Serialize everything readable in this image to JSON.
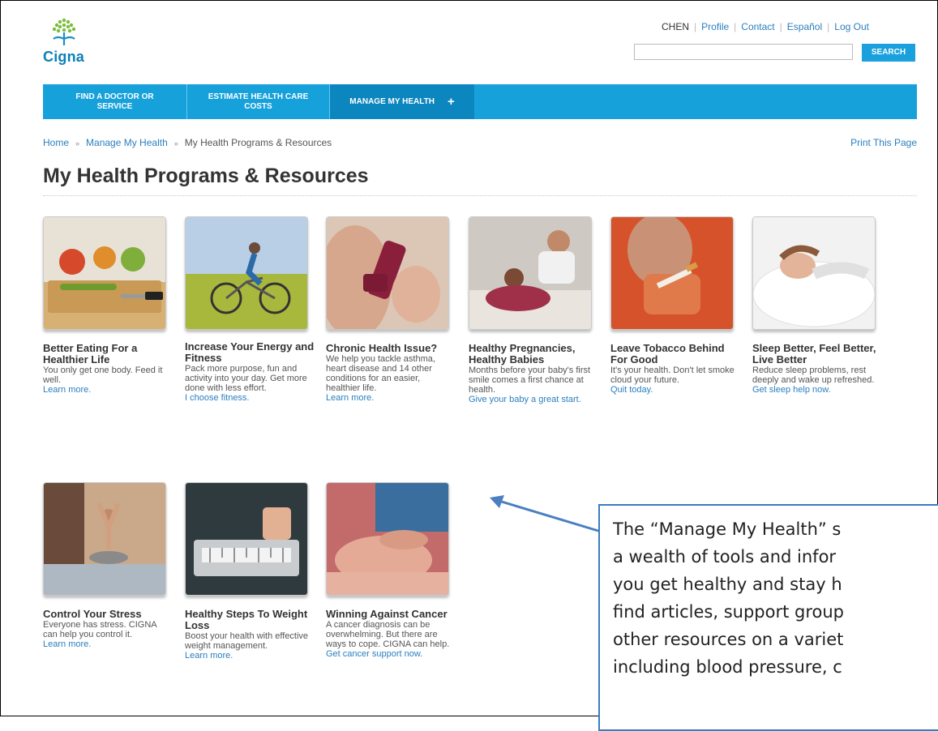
{
  "brand": {
    "logo_text": "Cigna",
    "accent": "#17a1db",
    "link": "#2a7fbf"
  },
  "util": {
    "user": "CHEN",
    "profile": "Profile",
    "contact": "Contact",
    "espanol": "Español",
    "logout": "Log Out"
  },
  "search": {
    "placeholder": "",
    "button": "SEARCH"
  },
  "nav": {
    "find_doctor": "FIND A DOCTOR OR SERVICE",
    "estimate": "ESTIMATE HEALTH CARE COSTS",
    "manage": "MANAGE MY HEALTH",
    "plus": "+"
  },
  "breadcrumb": {
    "home": "Home",
    "manage": "Manage My Health",
    "current": "My Health Programs & Resources",
    "sep": "»"
  },
  "print": "Print This Page",
  "page_title": "My Health Programs & Resources",
  "cards": [
    {
      "title": "Better Eating For a Healthier Life",
      "desc": "You only get one body. Feed it well.",
      "link": "Learn more."
    },
    {
      "title": "Increase Your Energy and Fitness",
      "desc": "Pack more purpose, fun and activity into your day. Get more done with less effort.",
      "link": "I choose fitness."
    },
    {
      "title": "Chronic Health Issue?",
      "desc": "We help you tackle asthma, heart disease and 14 other conditions for an easier, healthier life.",
      "link": "Learn more."
    },
    {
      "title": "Healthy Pregnancies, Healthy Babies",
      "desc": "Months before your baby's first smile comes a first chance at health.",
      "link": "Give your baby a great start."
    },
    {
      "title": "Leave Tobacco Behind For Good",
      "desc": "It's your health. Don't let smoke cloud your future.",
      "link": "Quit today."
    },
    {
      "title": "Sleep Better, Feel Better, Live Better",
      "desc": "Reduce sleep problems, rest deeply and wake up refreshed.",
      "link": "Get sleep help now."
    },
    {
      "title": "Control Your Stress",
      "desc": "Everyone has stress. CIGNA can help you control it.",
      "link": "Learn more."
    },
    {
      "title": "Healthy Steps To Weight Loss",
      "desc": "Boost your health with effective weight management.",
      "link": "Learn more."
    },
    {
      "title": "Winning Against Cancer",
      "desc": "A cancer diagnosis can be overwhelming. But there are ways to cope. CIGNA can help.",
      "link": "Get cancer support now."
    }
  ],
  "callout": {
    "lines": [
      "The “Manage My Health” s",
      "a wealth of tools and infor",
      "you get healthy and stay h",
      "find articles, support group",
      "other resources on a variet",
      "including blood pressure, c"
    ]
  }
}
